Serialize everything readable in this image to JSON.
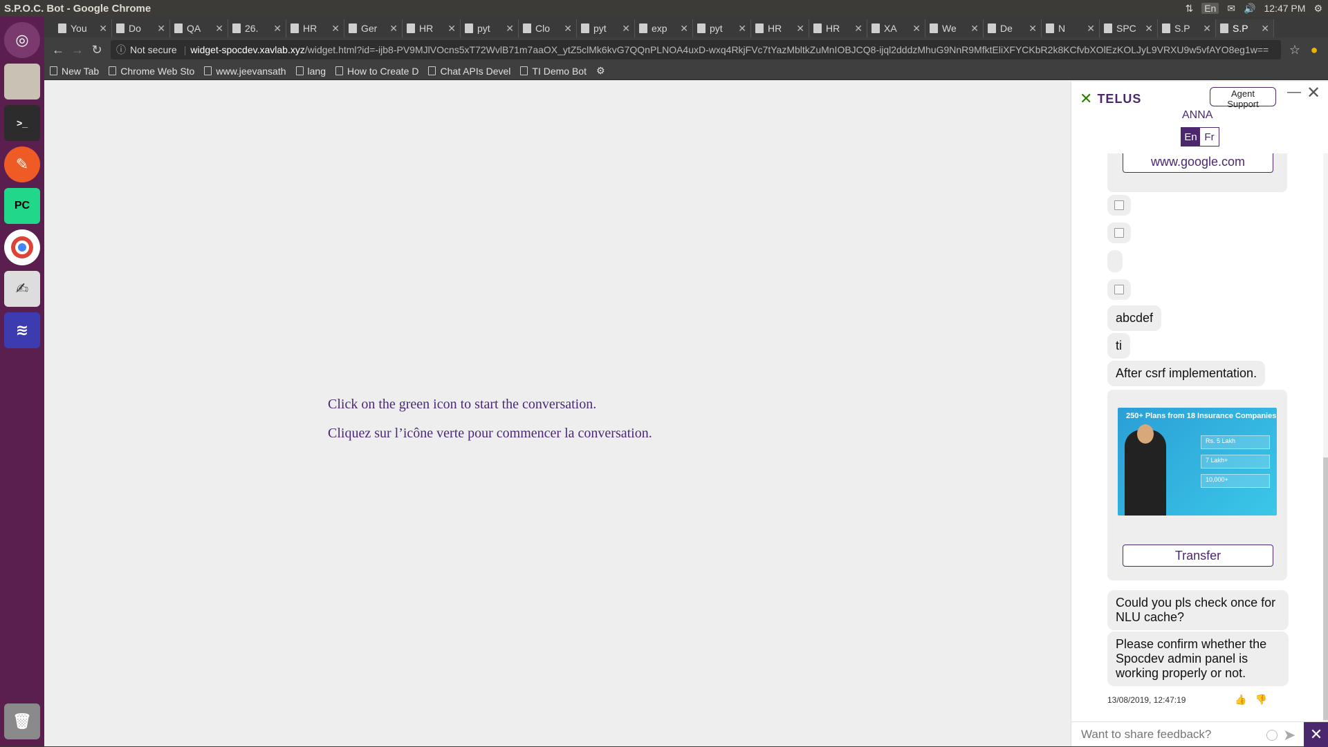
{
  "os": {
    "window_title": "S.P.O.C. Bot - Google Chrome",
    "tray": {
      "lang": "En",
      "time": "12:47 PM"
    }
  },
  "launcher": [
    "ubuntu-dash-icon",
    "files-icon",
    "terminal-icon",
    "postman-icon",
    "pycharm-icon",
    "chrome-icon",
    "text-editor-icon",
    "remmina-icon",
    "trash-icon"
  ],
  "browser": {
    "tabs": [
      "You",
      "Do",
      "QA",
      "26.",
      "HR",
      "Ger",
      "HR",
      "pyt",
      "Clo",
      "pyt",
      "exp",
      "pyt",
      "HR",
      "HR",
      "XA",
      "We",
      "De",
      "N",
      "SPC",
      "S.P",
      "S.P"
    ],
    "not_secure": "Not secure",
    "url_host": "widget-spocdev.xavlab.xyz",
    "url_rest": "/widget.html?id=-ijb8-PV9MJlVOcns5xT72WvlB71m7aaOX_ytZ5clMk6kvG7QQnPLNOA4uxD-wxq4RkjFVc7tYazMbltkZuMnIOBJCQ8-ijql2dddzMhuG9NnR9MfktEliXFYCKbR2k8KCfvbXOlEzKOLJyL9VRXU9w5vfAYO8eg1w==",
    "bookmarks": [
      "New Tab",
      "Chrome Web Sto",
      "www.jeevansath",
      "lang",
      "How to Create D",
      "Chat APIs Devel",
      "TI Demo Bot"
    ]
  },
  "page": {
    "line_en": "Click on the green icon to start the conversation.",
    "line_fr": "Cliquez sur l’icône verte pour commencer la conversation."
  },
  "widget": {
    "brand": "TELUS",
    "agent_support": "Agent Support",
    "bot_name": "ANNA",
    "lang_en": "En",
    "lang_fr": "Fr",
    "link_button": "www.google.com",
    "messages": [
      "abcdef",
      "ti",
      "After csrf implementation.",
      "Could you pls check once for NLU cache?",
      "Please confirm whether the Spocdev admin panel is working properly or not."
    ],
    "banner": {
      "headline": "250+ Plans from 18 Insurance Companies",
      "stats": [
        "Rs. 5 Lakh",
        "7 Lakh+",
        "10,000+"
      ]
    },
    "transfer_button": "Transfer",
    "timestamp": "13/08/2019, 12:47:19",
    "input_placeholder": "Want to share feedback?"
  }
}
